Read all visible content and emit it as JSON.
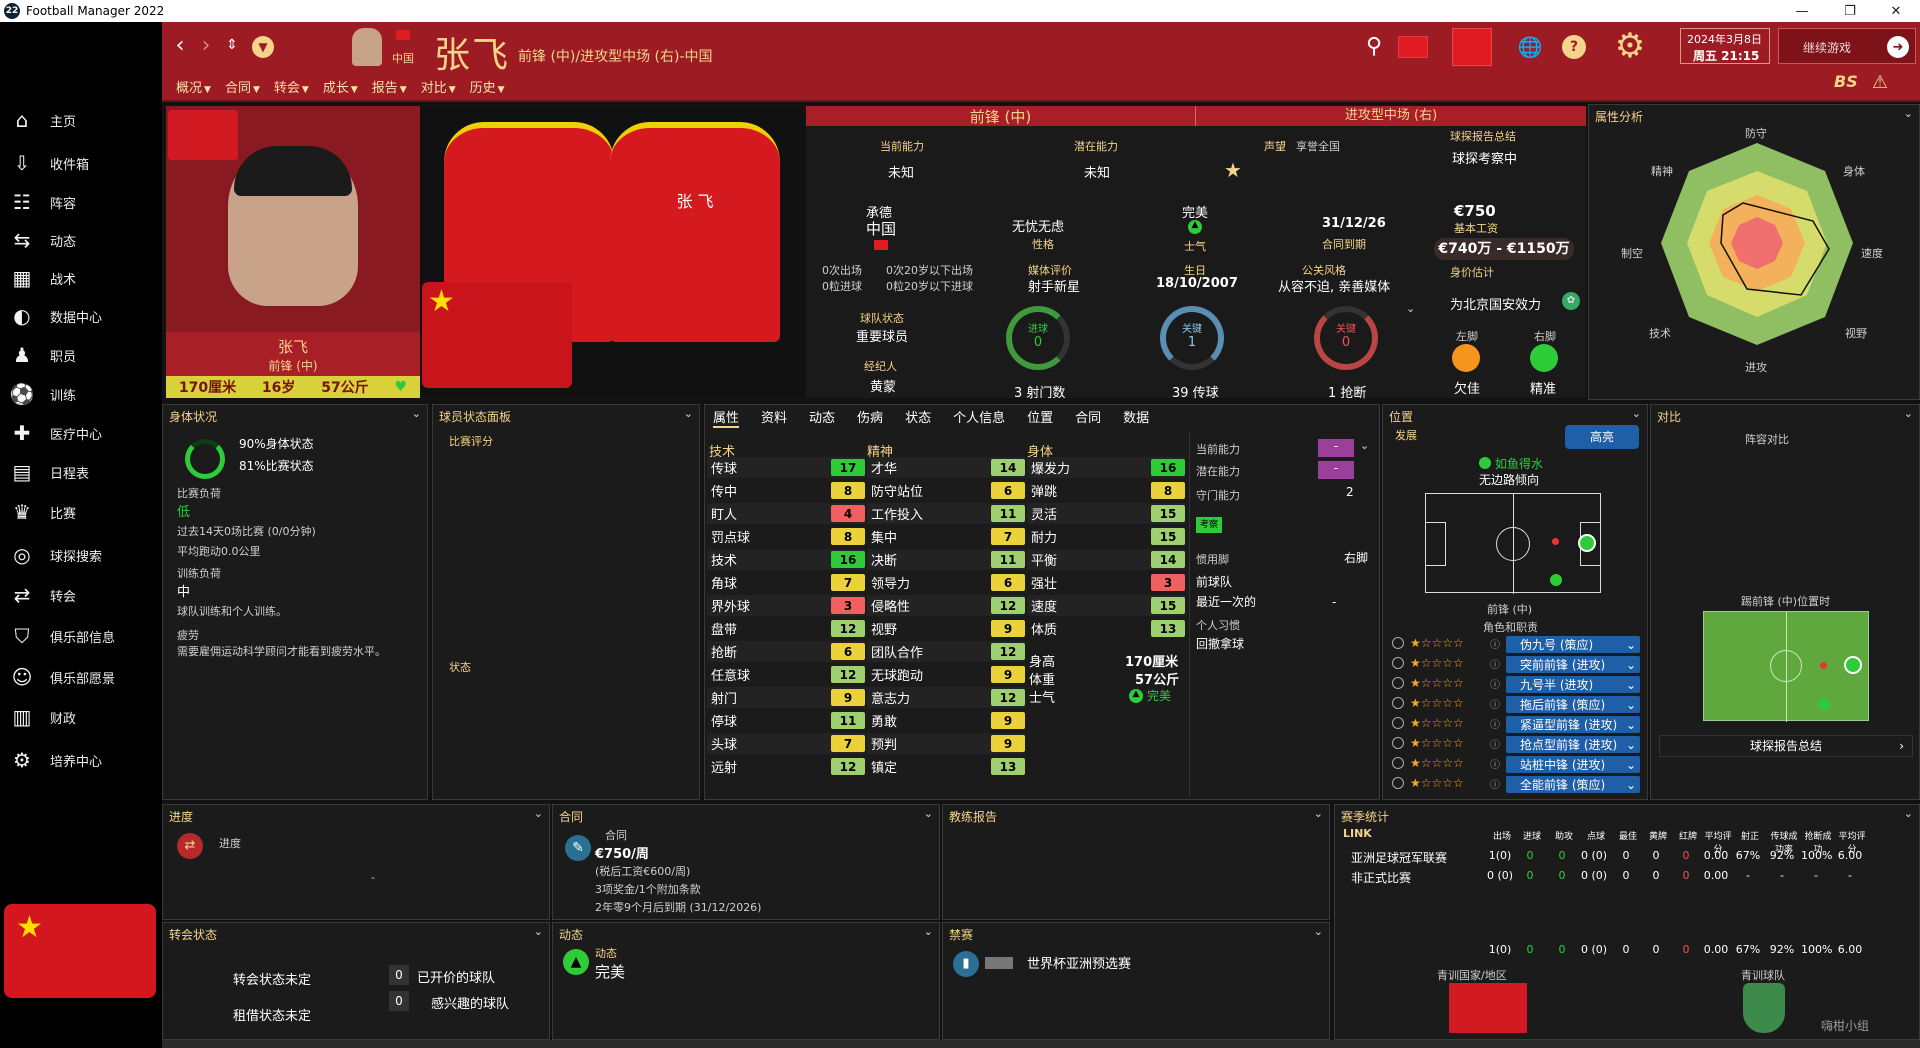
{
  "window": {
    "title": "Football Manager 2022",
    "logo": "22"
  },
  "sidebar": {
    "items": [
      {
        "label": "主页",
        "icon": "home-icon"
      },
      {
        "label": "收件箱",
        "icon": "inbox-icon"
      },
      {
        "label": "阵容",
        "icon": "squad-icon"
      },
      {
        "label": "动态",
        "icon": "dynamics-icon"
      },
      {
        "label": "战术",
        "icon": "tactics-icon"
      },
      {
        "label": "数据中心",
        "icon": "data-hub-icon"
      },
      {
        "label": "职员",
        "icon": "staff-icon"
      },
      {
        "label": "训练",
        "icon": "training-icon"
      },
      {
        "label": "医疗中心",
        "icon": "medical-icon"
      },
      {
        "label": "日程表",
        "icon": "calendar-icon"
      },
      {
        "label": "比赛",
        "icon": "trophy-icon"
      },
      {
        "label": "球探搜索",
        "icon": "scouting-icon"
      },
      {
        "label": "转会",
        "icon": "transfers-icon"
      },
      {
        "label": "俱乐部信息",
        "icon": "club-info-icon"
      },
      {
        "label": "俱乐部愿景",
        "icon": "club-vision-icon"
      },
      {
        "label": "财政",
        "icon": "finances-icon"
      },
      {
        "label": "培养中心",
        "icon": "development-icon"
      }
    ]
  },
  "header": {
    "country": "中国",
    "player_name": "张飞",
    "position_line": "前锋 (中)/进攻型中场 (右)-中国",
    "date": "2024年3月8日",
    "time": "周五 21:15",
    "continue": "继续游戏",
    "bs": "BS",
    "tabs": [
      "概况",
      "合同",
      "转会",
      "成长",
      "报告",
      "对比",
      "历史"
    ]
  },
  "profile": {
    "name": "张飞",
    "position": "前锋 (中)",
    "height": "170厘米",
    "age": "16岁",
    "weight": "57公斤",
    "shirt_name": "张 飞"
  },
  "overview": {
    "pos1": "前锋 (中)",
    "pos2": "进攻型中场 (右)",
    "ca_label": "当前能力",
    "ca_value": "未知",
    "pa_label": "潜在能力",
    "pa_value": "未知",
    "rep_label": "声望",
    "rep_value": "享誉全国",
    "scout_label": "球探报告总结",
    "scout_value": "球探考察中",
    "club": "承德",
    "nation": "中国",
    "apps1": "0次出场",
    "apps2": "0次20岁以下出场",
    "goals1": "0粒进球",
    "goals2": "0粒20岁以下进球",
    "personality_value": "无忧无虑",
    "personality_label": "性格",
    "morale_value": "完美",
    "morale_label": "士气",
    "contract_value": "31/12/26",
    "contract_label": "合同到期",
    "wage_value": "€750",
    "wage_label": "基本工资",
    "value_range": "€740万 - €1150万",
    "value_label": "身价估计",
    "media_label": "媒体评价",
    "media_value": "射手新星",
    "dob_label": "生日",
    "dob_value": "18/10/2007",
    "pr_label": "公关风格",
    "pr_value": "从容不迫, 亲善媒体",
    "squad_label": "球队状态",
    "squad_value": "重要球员",
    "agent_label": "经纪人",
    "agent_value": "黄蒙",
    "g1_label": "进球",
    "g1_value": "0",
    "g1_caption": "3 射门数",
    "g2_label": "关键",
    "g2_value": "1",
    "g2_caption": "39 传球",
    "g3_label": "关键",
    "g3_value": "0",
    "g3_caption": "1 抢断",
    "club_fav": "为北京国安效力",
    "left_foot_label": "左脚",
    "left_foot_value": "欠佳",
    "right_foot_label": "右脚",
    "right_foot_value": "精准"
  },
  "analysis": {
    "title": "属性分析",
    "labels": [
      "防守",
      "身体",
      "速度",
      "视野",
      "进攻",
      "技术",
      "制空",
      "精神"
    ]
  },
  "condition": {
    "title": "身体状况",
    "fitness": "90%身体状态",
    "match": "81%比赛状态",
    "load_label": "比赛负荷",
    "load_value": "低",
    "recent": "过去14天0场比赛 (0/0分钟)",
    "distance": "平均跑动0.0公里",
    "train_label": "训练负荷",
    "train_value": "中",
    "train_desc": "球队训练和个人训练。",
    "fatigue_label": "疲劳",
    "fatigue_desc": "需要雇佣运动科学顾问才能看到疲劳水平。"
  },
  "form": {
    "title": "球员状态面板",
    "rating": "比赛评分",
    "status": "状态"
  },
  "tabs2": [
    "属性",
    "资料",
    "动态",
    "伤病",
    "状态",
    "个人信息",
    "位置",
    "合同",
    "数据"
  ],
  "attributes": {
    "tech_title": "技术",
    "mental_title": "精神",
    "physical_title": "身体",
    "technical": [
      [
        "传球",
        "17"
      ],
      [
        "传中",
        "8"
      ],
      [
        "盯人",
        "4"
      ],
      [
        "罚点球",
        "8"
      ],
      [
        "技术",
        "16"
      ],
      [
        "角球",
        "7"
      ],
      [
        "界外球",
        "3"
      ],
      [
        "盘带",
        "12"
      ],
      [
        "抢断",
        "6"
      ],
      [
        "任意球",
        "12"
      ],
      [
        "射门",
        "9"
      ],
      [
        "停球",
        "11"
      ],
      [
        "头球",
        "7"
      ],
      [
        "远射",
        "12"
      ]
    ],
    "mental": [
      [
        "才华",
        "14"
      ],
      [
        "防守站位",
        "6"
      ],
      [
        "工作投入",
        "11"
      ],
      [
        "集中",
        "7"
      ],
      [
        "决断",
        "11"
      ],
      [
        "领导力",
        "6"
      ],
      [
        "侵略性",
        "12"
      ],
      [
        "视野",
        "9"
      ],
      [
        "团队合作",
        "12"
      ],
      [
        "无球跑动",
        "9"
      ],
      [
        "意志力",
        "12"
      ],
      [
        "勇敢",
        "9"
      ],
      [
        "预判",
        "9"
      ],
      [
        "镇定",
        "13"
      ]
    ],
    "physical": [
      [
        "爆发力",
        "16"
      ],
      [
        "弹跳",
        "8"
      ],
      [
        "灵活",
        "15"
      ],
      [
        "耐力",
        "15"
      ],
      [
        "平衡",
        "14"
      ],
      [
        "强壮",
        "3"
      ],
      [
        "速度",
        "15"
      ],
      [
        "体质",
        "13"
      ]
    ],
    "height_label": "身高",
    "height_value": "170厘米",
    "weight_label": "体重",
    "weight_value": "57公斤",
    "morale_label": "士气",
    "morale_value": "完美"
  },
  "sidepanel": {
    "ca": "当前能力",
    "pa": "潜在能力",
    "gk": "守门能力",
    "gk_value": "2",
    "badge": "考察",
    "foot_label": "惯用脚",
    "foot_value": "右脚",
    "former": "前球队",
    "recent": "最近一次的",
    "recent_value": "-",
    "habit": "个人习惯",
    "habit_value": "回撤拿球"
  },
  "position": {
    "title": "位置",
    "develop": "发展",
    "highlight": "高亮",
    "state": "如鱼得水",
    "tendency": "无边路倾向",
    "pos_label": "前锋 (中)",
    "roles_label": "角色和职责",
    "roles": [
      "伪九号 (策应)",
      "突前前锋 (进攻)",
      "九号半 (进攻)",
      "拖后前锋 (策应)",
      "紧逼型前锋 (进攻)",
      "抢点型前锋 (进攻)",
      "站桩中锋 (进攻)",
      "全能前锋 (策应)"
    ]
  },
  "compare": {
    "title": "对比",
    "lineup": "阵容对比",
    "pos_caption": "踢前锋 (中)位置时",
    "scout": "球探报告总结"
  },
  "progress": {
    "title": "进度",
    "label": "进度",
    "dash": "-"
  },
  "contract": {
    "title": "合同",
    "label": "合同",
    "wage": "€750/周",
    "after_tax": "(税后工资€600/周)",
    "bonus": "3项奖金/1个附加条款",
    "remaining": "2年零9个月后到期 (31/12/2026)"
  },
  "coach": {
    "title": "教练报告"
  },
  "season": {
    "title": "赛季统计",
    "link": "LINK",
    "cols": [
      "出场",
      "进球",
      "助攻",
      "点球",
      "最佳",
      "黄牌",
      "红牌",
      "平均评分",
      "射正",
      "传球成功率",
      "抢断成功",
      "平均评分"
    ],
    "rows": [
      {
        "comp": "亚洲足球冠军联赛",
        "vals": [
          "1(0)",
          "0",
          "0",
          "0 (0)",
          "0",
          "0",
          "0",
          "0.00",
          "67%",
          "92%",
          "100%",
          "6.00"
        ]
      },
      {
        "comp": "非正式比赛",
        "vals": [
          "0 (0)",
          "0",
          "0",
          "0 (0)",
          "0",
          "0",
          "0",
          "0.00",
          "-",
          "-",
          "-",
          "-"
        ]
      }
    ],
    "total": [
      "1(0)",
      "0",
      "0",
      "0 (0)",
      "0",
      "0",
      "0",
      "0.00",
      "67%",
      "92%",
      "100%",
      "6.00"
    ],
    "youth_nation": "青训国家/地区",
    "youth_club": "青训球队"
  },
  "transfer": {
    "title": "转会状态",
    "transfer_status": "转会状态未定",
    "loan_status": "租借状态未定",
    "bids": "0",
    "bids_label": "已开价的球队",
    "interest": "0",
    "interest_label": "感兴趣的球队"
  },
  "dynamics": {
    "title": "动态",
    "label": "动态",
    "value": "完美"
  },
  "ban": {
    "title": "禁赛",
    "value": "世界杯亚洲预选赛"
  },
  "watermark": "嗨柑小组",
  "colors": {
    "header_red": "#9d1c24",
    "accent_gold": "#f4d48a",
    "green": "#2fcc3a",
    "role_blue": "#1f5fa8"
  }
}
